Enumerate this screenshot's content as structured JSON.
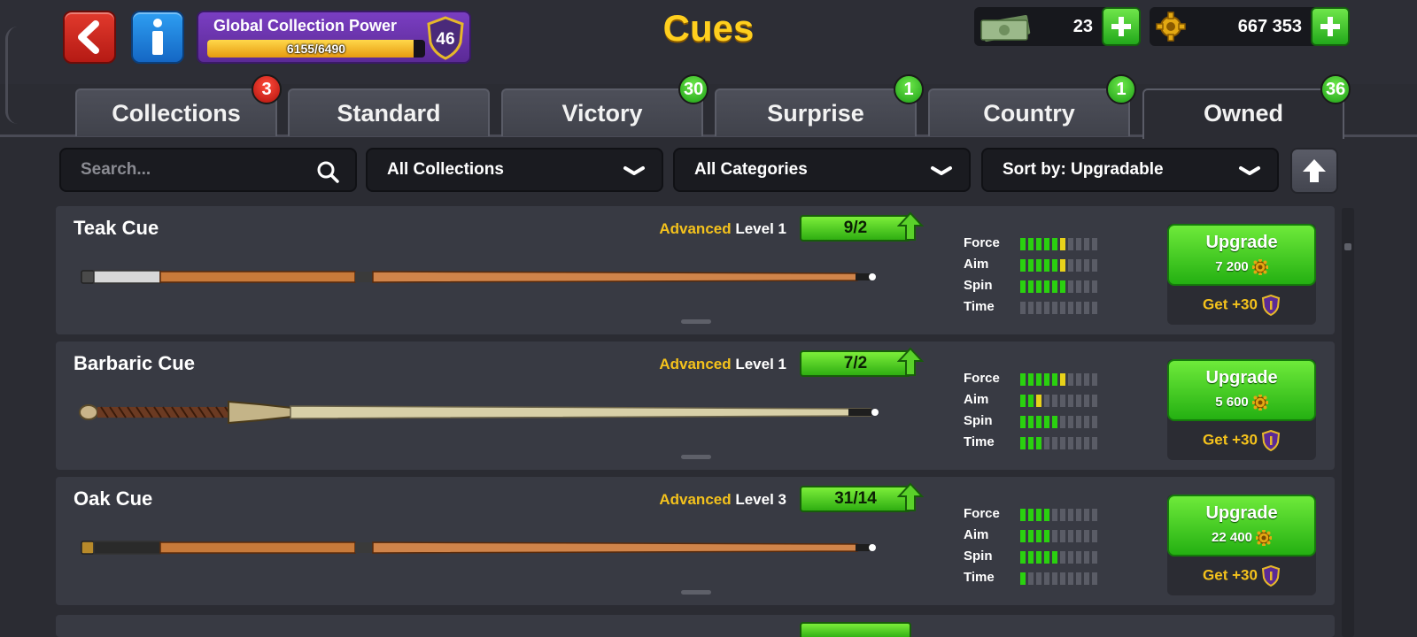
{
  "header": {
    "title": "Cues",
    "collection_power": {
      "label": "Global Collection Power",
      "progress_text": "6155/6490",
      "fraction": 0.948,
      "level": "46"
    },
    "cash": "23",
    "coins": "667 353"
  },
  "tabs": [
    {
      "label": "Collections",
      "badge": "3",
      "badge_color": "red"
    },
    {
      "label": "Standard",
      "badge": "",
      "badge_color": ""
    },
    {
      "label": "Victory",
      "badge": "30",
      "badge_color": "green"
    },
    {
      "label": "Surprise",
      "badge": "1",
      "badge_color": "green"
    },
    {
      "label": "Country",
      "badge": "1",
      "badge_color": "green"
    },
    {
      "label": "Owned",
      "badge": "36",
      "badge_color": "green",
      "active": true
    }
  ],
  "filters": {
    "search_placeholder": "Search...",
    "collections": "All Collections",
    "categories": "All Categories",
    "sort": "Sort by: Upgradable"
  },
  "colors": {
    "accent_gold": "#f4c21c",
    "green_button": "#2fae12",
    "stat_green": "#2ad10f",
    "stat_yellow": "#e8d21a"
  },
  "stat_labels": [
    "Force",
    "Aim",
    "Spin",
    "Time"
  ],
  "cues": [
    {
      "name": "Teak Cue",
      "rarity": "Advanced",
      "level": "Level 1",
      "progress": "9/2",
      "stats": {
        "force": [
          5,
          1
        ],
        "aim": [
          5,
          1
        ],
        "spin": [
          6,
          0
        ],
        "time": [
          0,
          0
        ]
      },
      "upgrade_label": "Upgrade",
      "upgrade_price": "7 200",
      "bonus": "Get +30"
    },
    {
      "name": "Barbaric Cue",
      "rarity": "Advanced",
      "level": "Level 1",
      "progress": "7/2",
      "stats": {
        "force": [
          5,
          1
        ],
        "aim": [
          2,
          1
        ],
        "spin": [
          5,
          0
        ],
        "time": [
          3,
          0
        ]
      },
      "upgrade_label": "Upgrade",
      "upgrade_price": "5 600",
      "bonus": "Get +30"
    },
    {
      "name": "Oak Cue",
      "rarity": "Advanced",
      "level": "Level 3",
      "progress": "31/14",
      "stats": {
        "force": [
          4,
          0
        ],
        "aim": [
          4,
          0
        ],
        "spin": [
          5,
          0
        ],
        "time": [
          1,
          0
        ]
      },
      "upgrade_label": "Upgrade",
      "upgrade_price": "22 400",
      "bonus": "Get +30"
    }
  ]
}
